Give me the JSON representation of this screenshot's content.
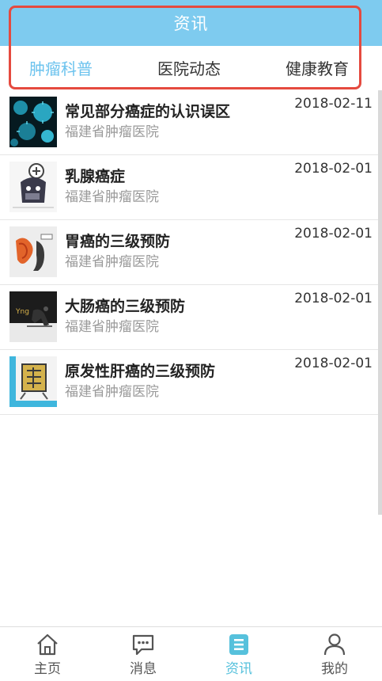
{
  "header": {
    "title": "资讯"
  },
  "tabs": [
    {
      "label": "肿瘤科普",
      "active": true
    },
    {
      "label": "医院动态",
      "active": false
    },
    {
      "label": "健康教育",
      "active": false
    }
  ],
  "articles": [
    {
      "title": "常见部分癌症的认识误区",
      "source": "福建省肿瘤医院",
      "date": "2018-02-11",
      "thumb_icon": "virus-cells-thumbnail"
    },
    {
      "title": "乳腺癌症",
      "source": "福建省肿瘤医院",
      "date": "2018-02-01",
      "thumb_icon": "breast-cancer-cartoon-thumbnail"
    },
    {
      "title": "胃癌的三级预防",
      "source": "福建省肿瘤医院",
      "date": "2018-02-01",
      "thumb_icon": "stomach-cancer-thumbnail"
    },
    {
      "title": "大肠癌的三级预防",
      "source": "福建省肿瘤医院",
      "date": "2018-02-01",
      "thumb_icon": "colon-cancer-thumbnail"
    },
    {
      "title": "原发性肝癌的三级预防",
      "source": "福建省肿瘤医院",
      "date": "2018-02-01",
      "thumb_icon": "liver-cancer-thumbnail"
    }
  ],
  "bottom_nav": [
    {
      "label": "主页",
      "icon": "home-icon",
      "active": false
    },
    {
      "label": "消息",
      "icon": "message-icon",
      "active": false
    },
    {
      "label": "资讯",
      "icon": "news-icon",
      "active": true
    },
    {
      "label": "我的",
      "icon": "profile-icon",
      "active": false
    }
  ],
  "colors": {
    "header_bg": "#7ecbef",
    "active_tab": "#6cc3ee",
    "highlight_border": "#e54a3f",
    "active_nav": "#56c1dc"
  }
}
